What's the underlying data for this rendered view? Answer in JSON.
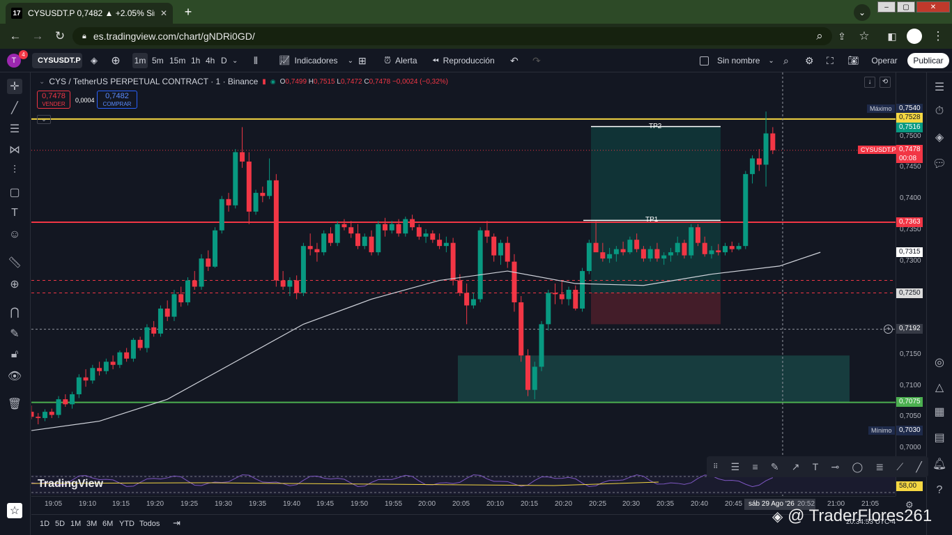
{
  "browser": {
    "tab_title": "CYSUSDT.P 0,7482 ▲ +2.05% Sin",
    "favicon": "17",
    "url": "es.tradingview.com/chart/gNDRi0GD/",
    "new_tab": "+",
    "close": "✕"
  },
  "toolbar": {
    "avatar": "T",
    "notif_count": "4",
    "symbol": "CYSUSDT.P",
    "intervals": [
      "1m",
      "5m",
      "15m",
      "1h",
      "4h",
      "D"
    ],
    "active_interval": "1m",
    "indicators": "Indicadores",
    "alert": "Alerta",
    "replay": "Reproducción",
    "layout_name": "Sin nombre",
    "trade": "Operar",
    "publish": "Publicar"
  },
  "legend": {
    "title": "CYS / TetherUS PERPETUAL CONTRACT · 1 · Binance",
    "o_label": "O",
    "o": "0,7499",
    "h_label": "H",
    "h": "0,7515",
    "l_label": "L",
    "l": "0,7472",
    "c_label": "C",
    "c": "0,7478",
    "chg": "−0,0024 (−0,32%)"
  },
  "order": {
    "sell_price": "0,7478",
    "sell_label": "VENDER",
    "spread": "0,0004",
    "buy_price": "0,7482",
    "buy_label": "COMPRAR"
  },
  "drawings": {
    "tp1": "TP1",
    "tp2": "TP2"
  },
  "price_scale": {
    "ticks": [
      "0,7500",
      "0,7450",
      "0,7400",
      "0,7350",
      "0,7300",
      "0,7150",
      "0,7100",
      "0,7050",
      "0,7000"
    ],
    "max_label": "Máximo",
    "max": "0,7540",
    "yellow": "0,7528",
    "tp2_green": "0,7516",
    "symbol_tag": "CYSUSDT.P",
    "last": "0,7478",
    "countdown": "00:08",
    "red_line": "0,7363",
    "ma": "0,7315",
    "stop": "0,7250",
    "dashed": "0,7192",
    "green_line": "0,7075",
    "min_label": "Mínimo",
    "min": "0,7030",
    "osc_val": "58,00"
  },
  "time_axis": {
    "labels": [
      "19:05",
      "19:10",
      "19:15",
      "19:20",
      "19:25",
      "19:30",
      "19:35",
      "19:40",
      "19:45",
      "19:50",
      "19:55",
      "20:00",
      "20:05",
      "20:10",
      "20:15",
      "20:20",
      "20:25",
      "20:30",
      "20:35",
      "20:40",
      "20:45",
      "20:52",
      "21:00",
      "21:05"
    ],
    "crosshair_date": "sáb 29 Ago '26",
    "clock": "20:34:53 UTC-4"
  },
  "ranges": [
    "1D",
    "5D",
    "1M",
    "3M",
    "6M",
    "YTD",
    "Todos"
  ],
  "watermark": "@ TraderFlores261",
  "logo": "TradingView",
  "colors": {
    "up": "#089981",
    "down": "#f23645",
    "yellow": "#f5d742",
    "red": "#f23645",
    "green": "#4caf50",
    "ma": "#d1d4dc"
  },
  "chart_data": {
    "type": "candlestick",
    "symbol": "CYSUSDT.P",
    "interval": "1m",
    "ylim": [
      0.699,
      0.756
    ],
    "x_start": "19:02",
    "candles": [
      [
        0.706,
        0.707,
        0.7048,
        0.7052
      ],
      [
        0.7052,
        0.7058,
        0.704,
        0.705
      ],
      [
        0.705,
        0.7064,
        0.7045,
        0.706
      ],
      [
        0.706,
        0.7065,
        0.705,
        0.7055
      ],
      [
        0.7055,
        0.7085,
        0.705,
        0.708
      ],
      [
        0.708,
        0.7088,
        0.7068,
        0.7072
      ],
      [
        0.7072,
        0.7092,
        0.7065,
        0.7088
      ],
      [
        0.7088,
        0.712,
        0.7082,
        0.7115
      ],
      [
        0.7115,
        0.7128,
        0.71,
        0.711
      ],
      [
        0.711,
        0.7135,
        0.7105,
        0.713
      ],
      [
        0.713,
        0.714,
        0.7118,
        0.7125
      ],
      [
        0.7125,
        0.7145,
        0.712,
        0.714
      ],
      [
        0.714,
        0.715,
        0.7128,
        0.7135
      ],
      [
        0.7135,
        0.7158,
        0.713,
        0.7155
      ],
      [
        0.7155,
        0.7162,
        0.714,
        0.7145
      ],
      [
        0.7145,
        0.7178,
        0.714,
        0.7175
      ],
      [
        0.7175,
        0.718,
        0.7158,
        0.7162
      ],
      [
        0.7162,
        0.72,
        0.7155,
        0.7195
      ],
      [
        0.7195,
        0.7205,
        0.718,
        0.7185
      ],
      [
        0.7185,
        0.723,
        0.718,
        0.7225
      ],
      [
        0.7225,
        0.7238,
        0.7205,
        0.7212
      ],
      [
        0.7212,
        0.7255,
        0.7205,
        0.7248
      ],
      [
        0.7248,
        0.726,
        0.7228,
        0.7235
      ],
      [
        0.7235,
        0.7275,
        0.723,
        0.727
      ],
      [
        0.727,
        0.7285,
        0.7255,
        0.726
      ],
      [
        0.726,
        0.7312,
        0.7255,
        0.7305
      ],
      [
        0.7305,
        0.7318,
        0.7285,
        0.7292
      ],
      [
        0.7292,
        0.7355,
        0.729,
        0.735
      ],
      [
        0.735,
        0.7405,
        0.7345,
        0.74
      ],
      [
        0.74,
        0.741,
        0.738,
        0.739
      ],
      [
        0.739,
        0.748,
        0.7385,
        0.7475
      ],
      [
        0.7475,
        0.7515,
        0.745,
        0.746
      ],
      [
        0.746,
        0.7475,
        0.736,
        0.738
      ],
      [
        0.738,
        0.7415,
        0.7375,
        0.741
      ],
      [
        0.741,
        0.742,
        0.7395,
        0.7405
      ],
      [
        0.7405,
        0.7465,
        0.74,
        0.743
      ],
      [
        0.743,
        0.744,
        0.726,
        0.727
      ],
      [
        0.727,
        0.7285,
        0.7255,
        0.726
      ],
      [
        0.726,
        0.7275,
        0.7245,
        0.727
      ],
      [
        0.727,
        0.7278,
        0.724,
        0.725
      ],
      [
        0.725,
        0.733,
        0.7245,
        0.7325
      ],
      [
        0.7325,
        0.7345,
        0.731,
        0.732
      ],
      [
        0.732,
        0.733,
        0.73,
        0.7315
      ],
      [
        0.7315,
        0.735,
        0.731,
        0.7345
      ],
      [
        0.7345,
        0.7355,
        0.7325,
        0.733
      ],
      [
        0.733,
        0.7365,
        0.7325,
        0.736
      ],
      [
        0.736,
        0.7368,
        0.735,
        0.7355
      ],
      [
        0.7355,
        0.7365,
        0.7338,
        0.7345
      ],
      [
        0.7345,
        0.736,
        0.732,
        0.7325
      ],
      [
        0.7325,
        0.7345,
        0.732,
        0.734
      ],
      [
        0.734,
        0.735,
        0.731,
        0.7315
      ],
      [
        0.7315,
        0.7365,
        0.731,
        0.736
      ],
      [
        0.736,
        0.737,
        0.734,
        0.735
      ],
      [
        0.735,
        0.7365,
        0.7345,
        0.736
      ],
      [
        0.736,
        0.7368,
        0.734,
        0.7345
      ],
      [
        0.7345,
        0.7372,
        0.734,
        0.7368
      ],
      [
        0.7368,
        0.7375,
        0.735,
        0.7355
      ],
      [
        0.7355,
        0.736,
        0.7335,
        0.734
      ],
      [
        0.734,
        0.7352,
        0.733,
        0.7345
      ],
      [
        0.7345,
        0.735,
        0.733,
        0.7335
      ],
      [
        0.7335,
        0.7345,
        0.732,
        0.7325
      ],
      [
        0.7325,
        0.734,
        0.7315,
        0.733
      ],
      [
        0.733,
        0.7338,
        0.7262,
        0.727
      ],
      [
        0.727,
        0.728,
        0.7245,
        0.725
      ],
      [
        0.725,
        0.7265,
        0.72,
        0.723
      ],
      [
        0.723,
        0.725,
        0.7225,
        0.724
      ],
      [
        0.724,
        0.7355,
        0.7235,
        0.735
      ],
      [
        0.735,
        0.7365,
        0.733,
        0.734
      ],
      [
        0.734,
        0.7345,
        0.73,
        0.731
      ],
      [
        0.731,
        0.7335,
        0.7295,
        0.733
      ],
      [
        0.733,
        0.734,
        0.729,
        0.73
      ],
      [
        0.73,
        0.7312,
        0.722,
        0.7235
      ],
      [
        0.7235,
        0.7245,
        0.714,
        0.715
      ],
      [
        0.715,
        0.716,
        0.7085,
        0.7095
      ],
      [
        0.7095,
        0.714,
        0.708,
        0.7132
      ],
      [
        0.7132,
        0.7205,
        0.7125,
        0.72
      ],
      [
        0.72,
        0.7255,
        0.719,
        0.725
      ],
      [
        0.725,
        0.7265,
        0.7232,
        0.7248
      ],
      [
        0.7248,
        0.7268,
        0.7232,
        0.724
      ],
      [
        0.724,
        0.726,
        0.723,
        0.7255
      ],
      [
        0.7255,
        0.7262,
        0.7222,
        0.7225
      ],
      [
        0.7225,
        0.729,
        0.722,
        0.7285
      ],
      [
        0.7285,
        0.7335,
        0.728,
        0.733
      ],
      [
        0.733,
        0.7365,
        0.732,
        0.7315
      ],
      [
        0.7315,
        0.733,
        0.73,
        0.7305
      ],
      [
        0.7305,
        0.7322,
        0.7298,
        0.7312
      ],
      [
        0.7312,
        0.7325,
        0.73,
        0.732
      ],
      [
        0.732,
        0.7332,
        0.731,
        0.7315
      ],
      [
        0.7315,
        0.734,
        0.7312,
        0.7335
      ],
      [
        0.7335,
        0.7345,
        0.7315,
        0.732
      ],
      [
        0.732,
        0.7325,
        0.73,
        0.7305
      ],
      [
        0.7305,
        0.7325,
        0.73,
        0.732
      ],
      [
        0.732,
        0.733,
        0.73,
        0.7305
      ],
      [
        0.7305,
        0.7315,
        0.7295,
        0.731
      ],
      [
        0.731,
        0.7322,
        0.73,
        0.7315
      ],
      [
        0.7315,
        0.734,
        0.731,
        0.733
      ],
      [
        0.733,
        0.7335,
        0.7305,
        0.731
      ],
      [
        0.731,
        0.736,
        0.7305,
        0.7355
      ],
      [
        0.7355,
        0.736,
        0.7325,
        0.733
      ],
      [
        0.733,
        0.734,
        0.7308,
        0.7312
      ],
      [
        0.7312,
        0.7325,
        0.7305,
        0.7318
      ],
      [
        0.7318,
        0.7328,
        0.731,
        0.7315
      ],
      [
        0.7315,
        0.733,
        0.731,
        0.7325
      ],
      [
        0.7325,
        0.7332,
        0.7315,
        0.732
      ],
      [
        0.732,
        0.733,
        0.7318,
        0.7325
      ],
      [
        0.7325,
        0.7445,
        0.732,
        0.744
      ],
      [
        0.744,
        0.747,
        0.7425,
        0.7465
      ],
      [
        0.7465,
        0.748,
        0.7445,
        0.7455
      ],
      [
        0.7455,
        0.754,
        0.742,
        0.7505
      ],
      [
        0.7505,
        0.7515,
        0.7472,
        0.7478
      ]
    ],
    "ma_line": [
      [
        0,
        0.703
      ],
      [
        10,
        0.7045
      ],
      [
        20,
        0.708
      ],
      [
        30,
        0.714
      ],
      [
        40,
        0.72
      ],
      [
        50,
        0.724
      ],
      [
        60,
        0.727
      ],
      [
        70,
        0.7285
      ],
      [
        80,
        0.7265
      ],
      [
        90,
        0.7262
      ],
      [
        100,
        0.728
      ],
      [
        110,
        0.7293
      ],
      [
        116,
        0.7315
      ]
    ],
    "levels": [
      {
        "name": "yellow",
        "price": 0.7528
      },
      {
        "name": "red",
        "price": 0.7363
      },
      {
        "name": "green",
        "price": 0.7075
      }
    ]
  }
}
